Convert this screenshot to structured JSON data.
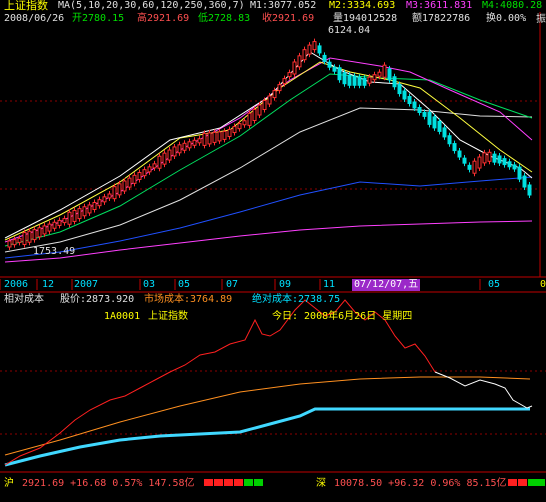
{
  "header": {
    "index_name": "上证指数",
    "ma_label": "MA(5,10,20,30,60,120,250,360,7)",
    "m1": "M1:3077.052",
    "m2": "M2:3334.693",
    "m3": "M3:3611.831",
    "m4": "M4:4080.28",
    "right_char": "振"
  },
  "quote": {
    "date": "2008/06/26",
    "open": "开2780.15",
    "high": "高2921.69",
    "low": "低2728.83",
    "close": "收2921.69",
    "volume": "量194012528",
    "amount": "额17822786",
    "turnover": "换0.00%"
  },
  "main_chart": {
    "peak_label": "6124.04",
    "trough_label": "1753.49"
  },
  "time_axis": {
    "labels": [
      "2006",
      "12",
      "2007",
      "03",
      "05",
      "07",
      "09",
      "11",
      "07/12/07,五",
      "05"
    ],
    "right_marker": "0"
  },
  "cost_panel": {
    "title": "相对成本",
    "price": "股价:2873.920",
    "market_cost": "市场成本:3764.89",
    "absolute_cost": "绝对成本:2738.75",
    "code": "1A0001",
    "name": "上证指数",
    "today": "今日: 2008年6月26日 星期四"
  },
  "status_bar": {
    "sh_label": "沪",
    "sh_values": "2921.69 +16.68 0.57% 147.58亿",
    "sz_label": "深",
    "sz_values": "10078.50 +96.32 0.96% 85.15亿"
  },
  "colors": {
    "candle_up": "#ff3030",
    "candle_down": "#00e0e0",
    "grid": "#8b0000",
    "highlight": "#9b28c8"
  }
}
